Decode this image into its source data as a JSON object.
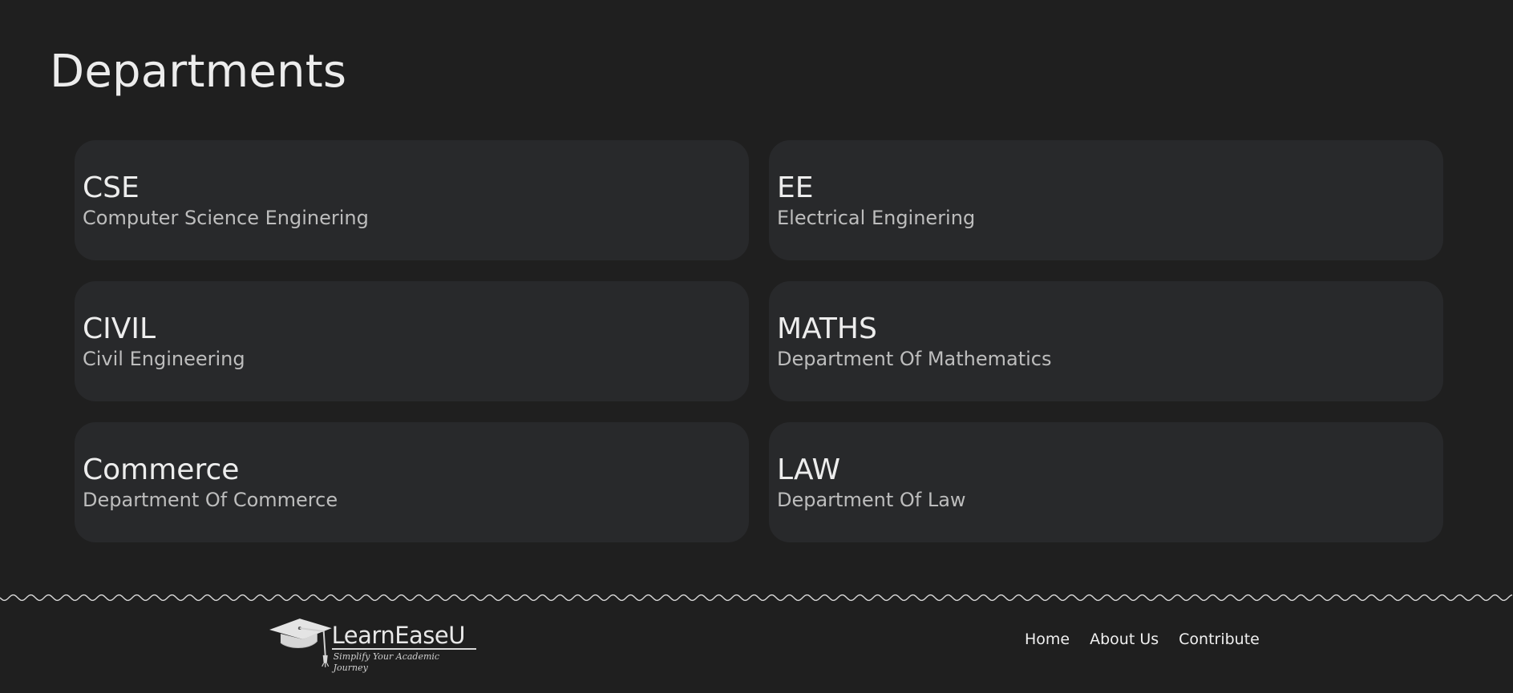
{
  "header": {
    "title": "Departments"
  },
  "departments": [
    {
      "code": "CSE",
      "name": "Computer Science Enginering"
    },
    {
      "code": "EE",
      "name": "Electrical Enginering"
    },
    {
      "code": "CIVIL",
      "name": "Civil Engineering"
    },
    {
      "code": "MATHS",
      "name": "Department Of Mathematics"
    },
    {
      "code": "Commerce",
      "name": "Department Of Commerce"
    },
    {
      "code": "LAW",
      "name": "Department Of Law"
    }
  ],
  "footer": {
    "logo_name": "LearnEaseU",
    "logo_tagline": "Simplify Your Academic Journey",
    "nav": [
      {
        "label": "Home"
      },
      {
        "label": "About Us"
      },
      {
        "label": "Contribute"
      }
    ]
  },
  "colors": {
    "background": "#1f1f1f",
    "card": "#28292b",
    "text_primary": "#ededed",
    "text_secondary": "#bdbdbd"
  },
  "icons": {
    "logo": "graduation-cap-icon"
  }
}
